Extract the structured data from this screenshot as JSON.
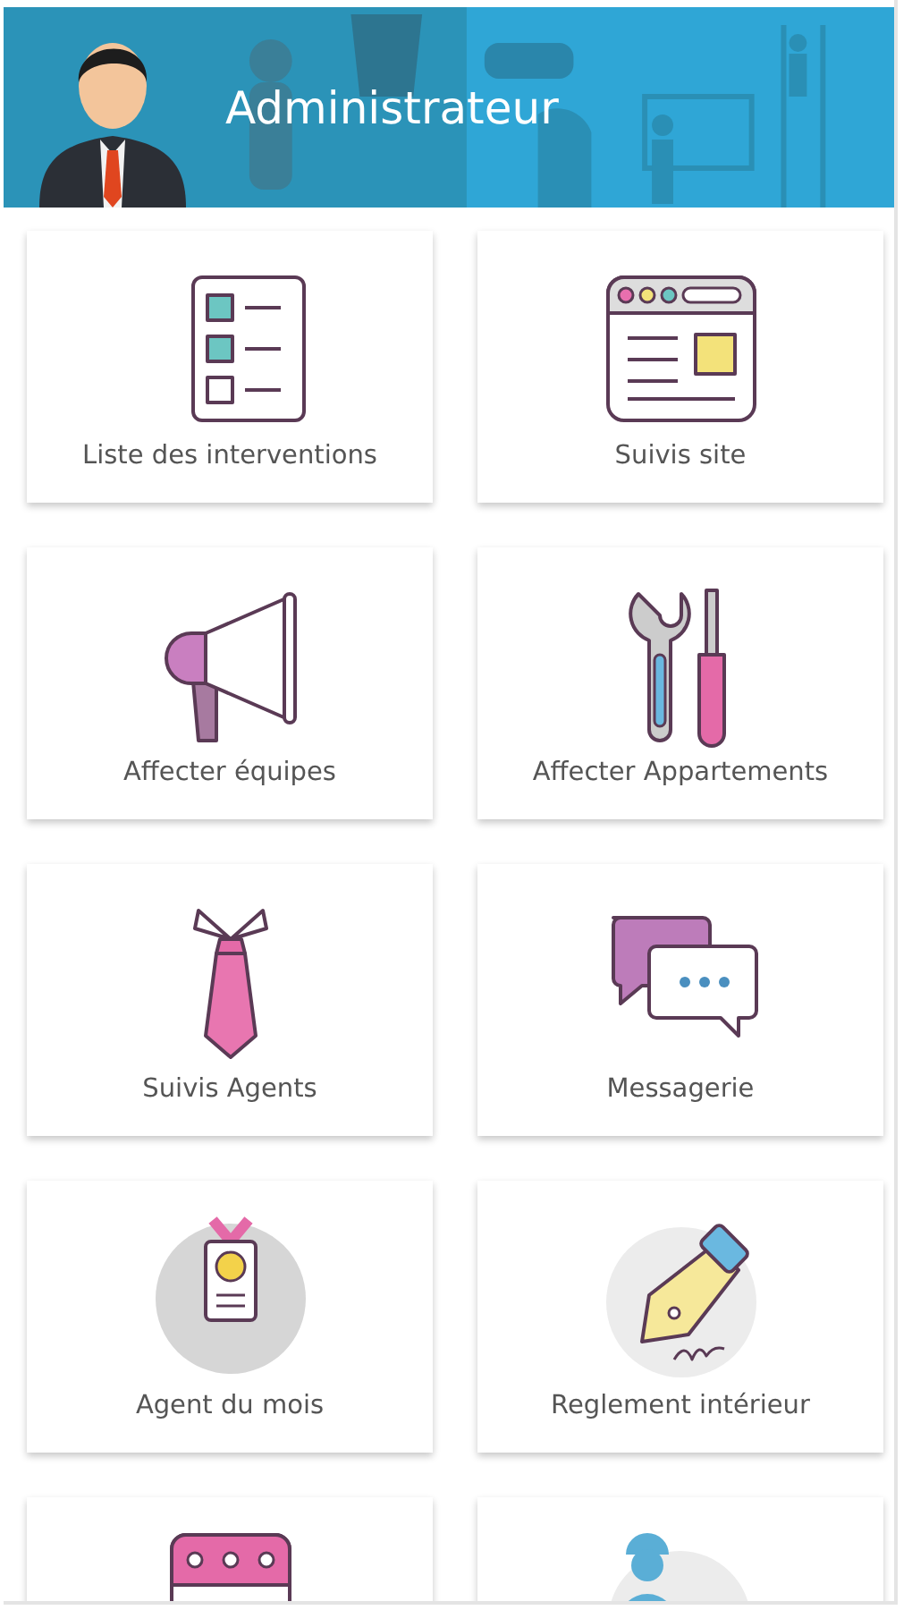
{
  "header": {
    "title": "Administrateur"
  },
  "menu": [
    {
      "kind": "checklist",
      "label": "Liste des interventions"
    },
    {
      "kind": "browser",
      "label": "Suivis site"
    },
    {
      "kind": "megaphone",
      "label": "Affecter équipes"
    },
    {
      "kind": "tools",
      "label": "Affecter Appartements"
    },
    {
      "kind": "tie",
      "label": "Suivis Agents"
    },
    {
      "kind": "chat",
      "label": "Messagerie"
    },
    {
      "kind": "badge",
      "label": "Agent du mois"
    },
    {
      "kind": "pen",
      "label": "Reglement intérieur"
    },
    {
      "kind": "calendar"
    },
    {
      "kind": "worker"
    }
  ]
}
